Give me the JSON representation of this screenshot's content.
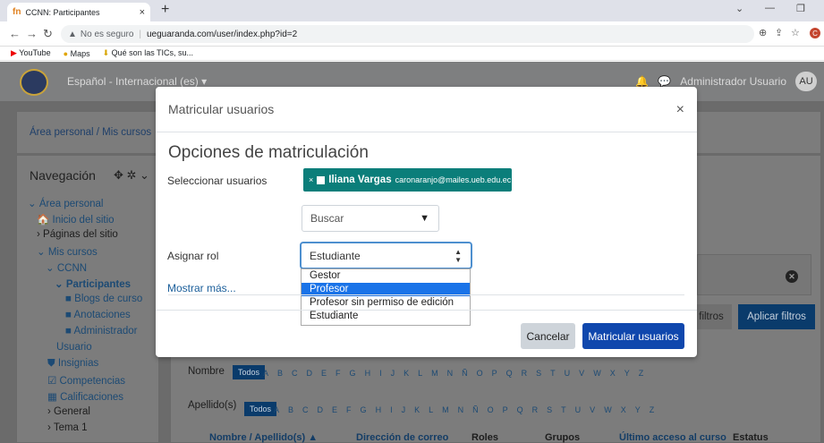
{
  "browser": {
    "tab_title": "CCNN: Participantes",
    "tab_icon_text": "fn",
    "new_tab": "+",
    "security": "No es seguro",
    "url_host": "ueguaranda.com/user/index.php?id=2",
    "bookmarks": [
      "YouTube",
      "Maps",
      "Qué son las TICs, su..."
    ],
    "profile_initial": "C"
  },
  "site": {
    "language": "Español - Internacional (es) ▾",
    "user_name": "Administrador Usuario",
    "user_initials": "AU",
    "breadcrumb": "Área personal / Mis cursos",
    "nav_title": "Navegación",
    "nav_items": [
      "⌄ Área personal",
      "🏠 Inicio del sitio",
      "› Páginas del sitio",
      "⌄ Mis cursos",
      "⌄ CCNN",
      "⌄ Participantes",
      "Blogs de curso",
      "Anotaciones",
      "Administrador",
      "Usuario",
      "Insignias",
      "Competencias",
      "Calificaciones",
      "› General",
      "› Tema 1"
    ],
    "filter_buttons": [
      "filtros",
      "Aplicar filtros"
    ],
    "nombre_label": "Nombre",
    "apellido_label": "Apellido(s)",
    "todos": "Todos",
    "letters": [
      "A",
      "B",
      "C",
      "D",
      "E",
      "F",
      "G",
      "H",
      "I",
      "J",
      "K",
      "L",
      "M",
      "N",
      "Ñ",
      "O",
      "P",
      "Q",
      "R",
      "S",
      "T",
      "U",
      "V",
      "W",
      "X",
      "Y",
      "Z"
    ],
    "table_headers": [
      "Nombre / Apellido(s) ▲",
      "Dirección de correo",
      "Roles",
      "Grupos",
      "Último acceso al curso",
      "Estatus"
    ]
  },
  "modal": {
    "title": "Matricular usuarios",
    "close": "×",
    "section_title": "Opciones de matriculación",
    "select_users_label": "Seleccionar usuarios",
    "chip_name": "Iliana Vargas",
    "chip_email": "caronaranjo@mailes.ueb.edu.ec",
    "search_placeholder": "Buscar",
    "role_label": "Asignar rol",
    "role_value": "Estudiante",
    "role_options": [
      "Gestor",
      "Profesor",
      "Profesor sin permiso de edición",
      "Estudiante"
    ],
    "role_highlighted": "Profesor",
    "show_more": "Mostrar más...",
    "cancel": "Cancelar",
    "submit": "Matricular usuarios"
  }
}
